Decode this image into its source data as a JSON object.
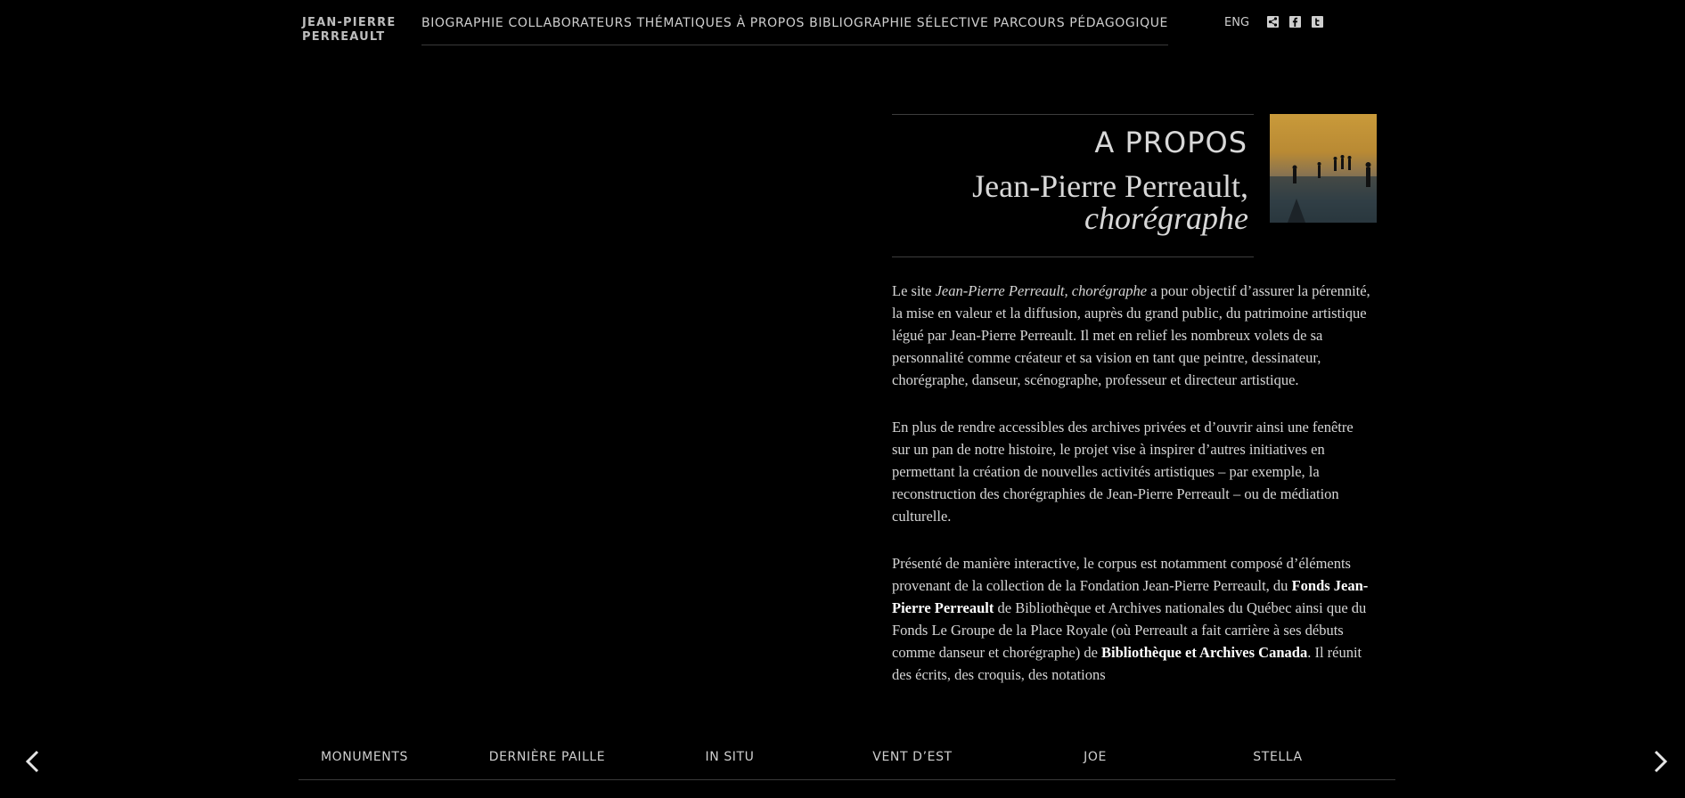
{
  "logo": {
    "line1": "JEAN-PIERRE",
    "line2": "PERREAULT"
  },
  "nav": {
    "items": [
      {
        "label": "BIOGRAPHIE"
      },
      {
        "label": "COLLABORATEURS"
      },
      {
        "label": "THÉMATIQUES"
      },
      {
        "label": "À PROPOS"
      },
      {
        "label": "BIBLIOGRAPHIE SÉLECTIVE"
      },
      {
        "label": "PARCOURS PÉDAGOGIQUE"
      }
    ],
    "lang": "ENG",
    "social_icons": [
      "share-icon",
      "facebook-icon",
      "twitter-icon"
    ]
  },
  "page": {
    "kicker": "A PROPOS",
    "title_line1": "Jean-Pierre Perreault,",
    "title_line2": "chorégraphe"
  },
  "body": {
    "p1": {
      "pre": "Le site ",
      "italic": "Jean-Pierre Perreault, chorégraphe",
      "post": " a pour objectif d’assurer la pérennité, la mise en valeur et la diffusion, auprès du grand public, du patrimoine artistique légué par Jean-Pierre Perreault. Il met en relief les nombreux volets de sa personnalité comme créateur et sa vision en tant que peintre, dessinateur, chorégraphe, danseur, scénographe, professeur et directeur artistique."
    },
    "p2": "En plus de rendre accessibles des archives privées et d’ouvrir ainsi une fenêtre sur un pan de notre histoire, le projet vise à inspirer d’autres initiatives en permettant la création de nouvelles activités artistiques – par exemple, la reconstruction des chorégraphies de Jean-Pierre Perreault – ou de médiation culturelle.",
    "p3": {
      "a": "Présenté de manière interactive, le corpus est notamment composé d’éléments provenant de la collection de la Fondation Jean-Pierre Perreault, du ",
      "link1": "Fonds Jean-Pierre Perreault",
      "b": " de Bibliothèque et Archives nationales du Québec ainsi que du Fonds Le Groupe de la Place Royale (où Perreault a fait carrière à ses débuts comme danseur et chorégraphe) de ",
      "link2": "Bibliothèque et Archives Canada",
      "c": ". Il réunit des écrits, des croquis, des notations"
    }
  },
  "bottom_nav": {
    "items": [
      {
        "label": "MONUMENTS"
      },
      {
        "label": "DERNIÈRE PAILLE"
      },
      {
        "label": "IN SITU"
      },
      {
        "label": "VENT D’EST"
      },
      {
        "label": "JOE"
      },
      {
        "label": "STELLA"
      }
    ],
    "prev_icon": "chevron-left-icon",
    "next_icon": "chevron-right-icon"
  },
  "colors": {
    "background": "#000000",
    "text": "#d6d6d6",
    "divider": "#3a3a3a"
  }
}
